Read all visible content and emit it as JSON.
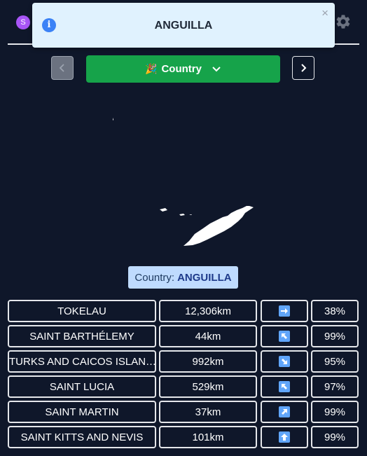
{
  "header": {
    "avatar_letter": "S"
  },
  "toast": {
    "title": "ANGUILLA",
    "close": "×",
    "info": "i"
  },
  "mode": {
    "label": "Country",
    "flag": "🎉"
  },
  "answer": {
    "prefix": "Country:",
    "value": "ANGUILLA"
  },
  "guesses": [
    {
      "name": "TOKELAU",
      "distance": "12,306km",
      "direction": "east",
      "percent": "38%"
    },
    {
      "name": "SAINT BARTHÉLEMY",
      "distance": "44km",
      "direction": "north-west",
      "percent": "99%"
    },
    {
      "name": "TURKS AND CAICOS ISLAN…",
      "distance": "992km",
      "direction": "south-east",
      "percent": "95%"
    },
    {
      "name": "SAINT LUCIA",
      "distance": "529km",
      "direction": "north-west",
      "percent": "97%"
    },
    {
      "name": "SAINT MARTIN",
      "distance": "37km",
      "direction": "north-east",
      "percent": "99%"
    },
    {
      "name": "SAINT KITTS AND NEVIS",
      "distance": "101km",
      "direction": "north",
      "percent": "99%"
    }
  ],
  "colors": {
    "background": "#0f172a",
    "primary": "#16a34a",
    "toast": "#e0f2fe",
    "badge": "#bfdbfe",
    "arrow": "#60a5fa"
  }
}
